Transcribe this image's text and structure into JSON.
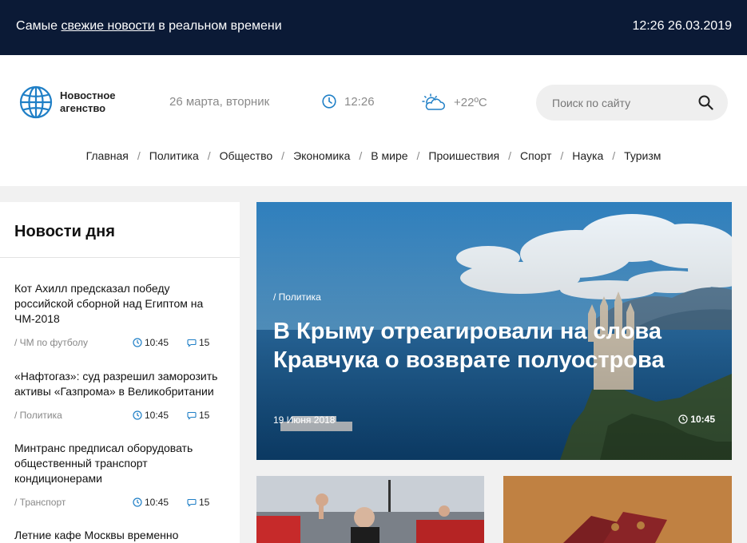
{
  "topbar": {
    "tagline_prefix": "Самые",
    "tagline_link": "свежие новости",
    "tagline_suffix": "в реальном времени",
    "datetime": "12:26 26.03.2019"
  },
  "header": {
    "logo_text": "Новостное агенство",
    "date": "26 марта, вторник",
    "time": "12:26",
    "weather": "+22ºC"
  },
  "search": {
    "placeholder": "Поиск по сайту"
  },
  "nav": [
    {
      "label": "Главная"
    },
    {
      "label": "Политика"
    },
    {
      "label": "Общество"
    },
    {
      "label": "Экономика"
    },
    {
      "label": "В мире"
    },
    {
      "label": "Проишествия"
    },
    {
      "label": "Спорт"
    },
    {
      "label": "Наука"
    },
    {
      "label": "Туризм"
    }
  ],
  "sidebar": {
    "title": "Новости дня",
    "items": [
      {
        "title": "Кот Ахилл предсказал победу российской сборной над Египтом на ЧМ-2018",
        "category": "/ ЧМ по футболу",
        "time": "10:45",
        "comments": "15"
      },
      {
        "title": "«Нафтогаз»: суд разрешил заморозить активы «Газпрома» в Великобритании",
        "category": "/ Политика",
        "time": "10:45",
        "comments": "15"
      },
      {
        "title": "Минтранс предписал оборудовать общественный транспорт кондиционерами",
        "category": "/ Транспорт",
        "time": "10:45",
        "comments": "15"
      },
      {
        "title": "Летние кафе Москвы временно",
        "category": "",
        "time": "",
        "comments": ""
      }
    ]
  },
  "hero": {
    "category": "/ Политика",
    "title": "В Крыму отреагировали на слова Кравчука о возврате полуострова",
    "date": "19 Июня 2018",
    "time": "10:45"
  },
  "colors": {
    "topbar_bg": "#0b1a36",
    "accent_icon": "#1f7fc6"
  }
}
